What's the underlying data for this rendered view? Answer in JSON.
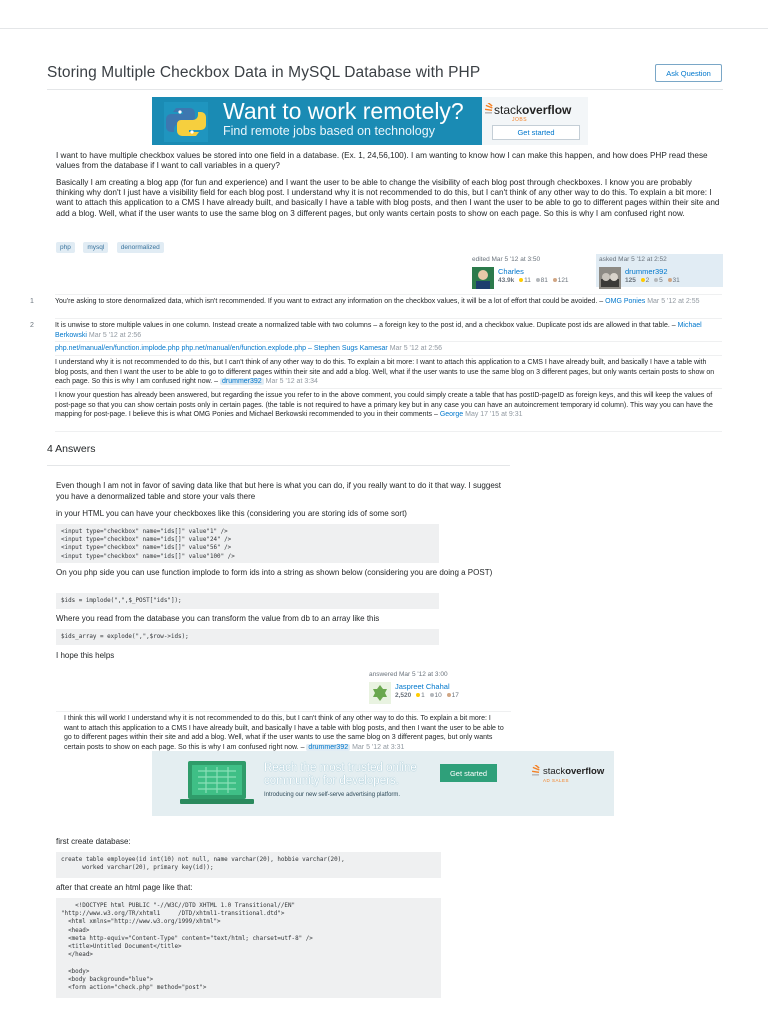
{
  "question": {
    "title": "Storing Multiple Checkbox Data in MySQL Database with PHP",
    "ask_button": "Ask Question",
    "body_p1": "I want to have multiple checkbox values be stored into one field in a database. (Ex. 1, 24,56,100). I am wanting to know how I can make this happen, and how does PHP read these values from the database if I want to call variables in a query?",
    "body_p2": "Basically I am creating a blog app (for fun and experience) and I want the user to be able to change the visibility of each blog post through checkboxes. I know you are probably thinking why don't I just have a visibility field for each blog post. I understand why it is not recommended to do this, but I can't think of any other way to do this. To explain a bit more: I want to attach this application to a CMS I have already built, and basically I have a table with blog posts, and then I want the user to be able to go to different pages within their site and add a blog. Well, what if the user wants to use the same blog on 3 different pages, but only wants certain posts to show on each page. So this is why I am confused right now.",
    "tags": [
      "php",
      "mysql",
      "denormalized"
    ],
    "edited": {
      "label": "edited Mar 5 '12 at 3:50",
      "user": "Charles",
      "rep": "43.9k",
      "gold": "11",
      "silver": "81",
      "bronze": "121"
    },
    "asked": {
      "label": "asked Mar 5 '12 at 2:52",
      "user": "drummer392",
      "rep": "125",
      "gold": "2",
      "silver": "5",
      "bronze": "31"
    }
  },
  "banner1": {
    "headline": "Want to work remotely?",
    "subline": "Find remote jobs based on technology",
    "brand_a": "stack",
    "brand_b": "overflow",
    "brand_sub": "JOBS",
    "button": "Get started"
  },
  "comments": [
    {
      "num": "1",
      "text": "You're asking to store denormalized data, which isn't recommended. If you want to extract any information on the checkbox values, it will be a lot of effort that could be avoided. –",
      "user": "OMG Ponies",
      "date": "Mar 5 '12 at 2:55"
    },
    {
      "num": "2",
      "text": "It is unwise to store multiple values in one column. Instead create a normalized table with two columns – a foreign key to the post id, and a checkbox value. Duplicate post ids are allowed in that table. –",
      "user": "Michael Berkowski",
      "date": "Mar 5 '12 at 2:56"
    },
    {
      "num": "",
      "text": "php.net/manual/en/function.implode.php php.net/manual/en/function.explode.php –",
      "user": "Stephen Sugs Kamesar",
      "date": "Mar 5 '12 at 2:56"
    },
    {
      "num": "",
      "text": "I understand why it is not recommended to do this, but I can't think of any other way to do this. To explain a bit more: I want to attach this application to a CMS I have already built, and basically I have a table with blog posts, and then I want the user to be able to go to different pages within their site and add a blog. Well, what if the user wants to use the same blog on 3 different pages, but only wants certain posts to show on each page. So this is why I am confused right now. –",
      "user": "drummer392",
      "date": "Mar 5 '12 at 3:34"
    },
    {
      "num": "",
      "text": "I know your question has already been answered, but regarding the issue you refer to in the above comment, you could simply create a table that has postID-pageID as foreign keys, and this will keep the values of post-page so that you can show certain posts only in certain pages. (the table is not required to have a primary key but in any case you can have an autoincrement temporary id column). This way you can have the mapping for post-page. I believe this is what OMG Ponies and Michael Berkowski recommended to you in their comments –",
      "user": "George",
      "date": "May 17 '15 at 9:31"
    }
  ],
  "answers": {
    "heading": "4 Answers",
    "a1_p1": "Even though I am not in favor of saving data like that but here is what you can do, if you really want to do it that way. I suggest you have a denormalized table and store your vals there",
    "a1_p2": "in your HTML you can have your checkboxes like this (considering you are storing ids of some sort)",
    "a1_code1": [
      "<input type=\"checkbox\" name=\"ids[]\" value\"1\" />",
      "<input type=\"checkbox\" name=\"ids[]\" value\"24\" />",
      "<input type=\"checkbox\" name=\"ids[]\" value\"56\" />",
      "<input type=\"checkbox\" name=\"ids[]\" value\"100\" />"
    ],
    "a1_p3": "On you php side you can use function implode to form ids into a string as shown below (considering you are doing a POST)",
    "a1_code2": "$ids = implode(\",\",$_POST[\"ids\"]);",
    "a1_p4": "Where you read from the database you can transform the value from db to an array like this",
    "a1_code3": "$ids_array = explode(\",\",$row->ids);",
    "a1_p5": "I hope this helps",
    "a1_card": {
      "label": "answered Mar 5 '12 at 3:00",
      "user": "Jaspreet Chahal",
      "rep": "2,520",
      "gold": "1",
      "silver": "10",
      "bronze": "17"
    },
    "a1_comment": {
      "text": "I think this will work! I understand why it is not recommended to do this, but I can't think of any other way to do this. To explain a bit more: I want to attach this application to a CMS I have already built, and basically I have a table with blog posts, and then I want the user to be able to go to different pages within their site and add a blog. Well, what if the user wants to use the same blog on 3 different pages, but only wants certain posts to show on each page. So this is why I am confused right now. –",
      "user": "drummer392",
      "date": "Mar 5 '12 at 3:31"
    },
    "a2_p1": "first create database:",
    "a2_code1": [
      "create table employee(id int(10) not null, name varchar(20), hobbie varchar(20),",
      "      worked varchar(20), primary key(id));"
    ],
    "a2_p2": "after that create an html page like that:",
    "a2_code2": [
      "    <!DOCTYPE html PUBLIC \"-//W3C//DTD XHTML 1.0 Transitional//EN\"",
      "\"http://www.w3.org/TR/xhtml1     /DTD/xhtml1-transitional.dtd\">",
      "  <html xmlns=\"http://www.w3.org/1999/xhtml\">",
      "  <head>",
      "  <meta http-equiv=\"Content-Type\" content=\"text/html; charset=utf-8\" />",
      "  <title>Untitled Document</title>",
      "  </head>",
      "",
      "  <body>",
      "  <body background=\"blue\">",
      "  <form action=\"check.php\" method=\"post\">"
    ]
  },
  "banner2": {
    "headline_1": "Reach the most trusted online",
    "headline_2": "community for developers.",
    "subline": "Introducing our new self-serve advertising platform.",
    "button": "Get started",
    "brand_a": "stack",
    "brand_b": "overflow",
    "brand_sub": "AD SALES"
  }
}
